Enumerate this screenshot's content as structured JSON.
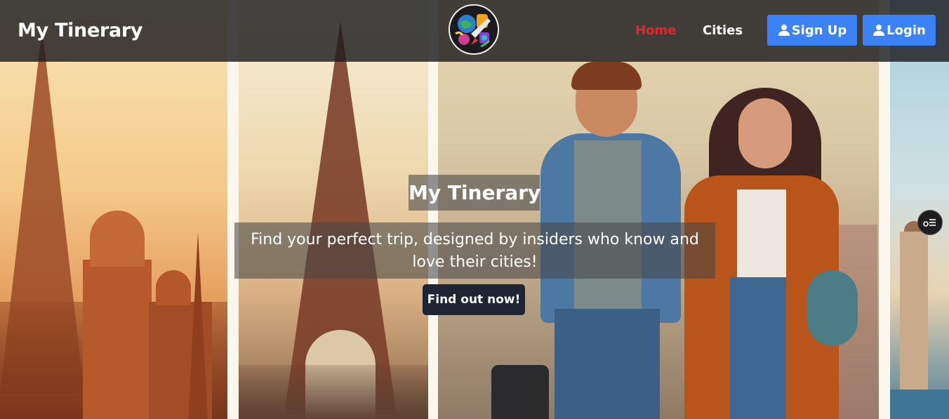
{
  "navbar": {
    "brand": "My Tinerary",
    "logo_icon": "travel-logo-icon",
    "links": [
      {
        "label": "Home",
        "active": true,
        "color": "#e0262e"
      },
      {
        "label": "Cities",
        "active": false,
        "color": "#ffffff"
      }
    ],
    "signup_label": "Sign Up",
    "login_label": "Login",
    "button_color": "#3b82f6"
  },
  "hero": {
    "title": "My Tinerary",
    "subtitle": "Find your perfect trip, designed by insiders who know and love their cities!",
    "cta_label": "Find out now!",
    "background_image": "illustrated-couple-travel-paris-collage"
  },
  "widget": {
    "icon": "settings-toggle-icon"
  }
}
